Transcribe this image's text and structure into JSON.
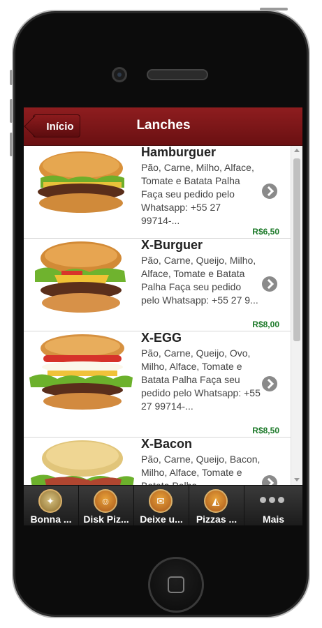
{
  "header": {
    "back_label": "Início",
    "title": "Lanches"
  },
  "items": [
    {
      "name": "Hamburguer",
      "desc": "Pão, Carne, Milho, Alface, Tomate e Batata Palha Faça seu pedido pelo Whatsapp: +55 27 99714-...",
      "price": "R$6,50"
    },
    {
      "name": "X-Burguer",
      "desc": "Pão, Carne, Queijo, Milho, Alface, Tomate e Batata Palha Faça seu pedido pelo Whatsapp: +55 27 9...",
      "price": "R$8,00"
    },
    {
      "name": "X-EGG",
      "desc": "Pão, Carne, Queijo, Ovo, Milho, Alface, Tomate e Batata Palha Faça seu pedido pelo Whatsapp: +55 27 99714-...",
      "price": "R$8,50"
    },
    {
      "name": "X-Bacon",
      "desc": "Pão, Carne, Queijo, Bacon, Milho, Alface, Tomate e Batata Palha",
      "price": ""
    }
  ],
  "tabs": [
    {
      "label": "Bonna ...",
      "icon": "logo-icon"
    },
    {
      "label": "Disk Piz...",
      "icon": "pizza-delivery-icon"
    },
    {
      "label": "Deixe u...",
      "icon": "message-icon"
    },
    {
      "label": "Pizzas ...",
      "icon": "pizza-slice-icon"
    },
    {
      "label": "Mais",
      "icon": "more-icon"
    }
  ],
  "colors": {
    "header": "#7a1517",
    "price": "#1d7a2a",
    "tabbar": "#2a2a2a"
  }
}
